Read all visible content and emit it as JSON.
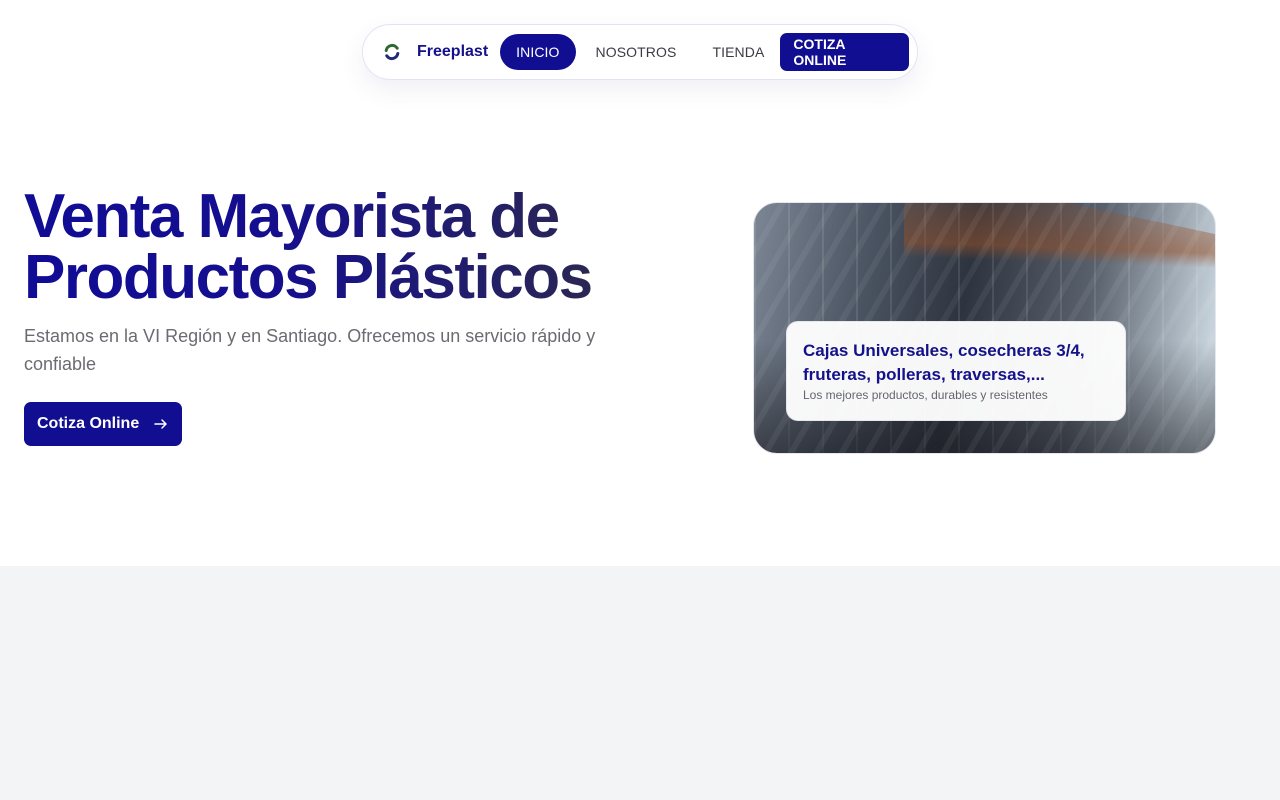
{
  "nav": {
    "brand": "Freeplast",
    "items": [
      {
        "label": "INICIO",
        "active": true
      },
      {
        "label": "NOSOTROS",
        "active": false
      },
      {
        "label": "TIENDA",
        "active": false
      }
    ],
    "cta": "COTIZA ONLINE",
    "logo_icon": "refresh-arrows-icon"
  },
  "hero": {
    "title_line1": "Venta Mayorista de",
    "title_line2": "Productos Plásticos",
    "subtitle": "Estamos en la VI Región y en Santiago. Ofrecemos un servicio rápido y confiable",
    "button_label": "Cotiza Online",
    "button_icon": "arrow-right-icon"
  },
  "feature_card": {
    "title": "Cajas Universales, cosecheras 3/4, fruteras, polleras, traversas,...",
    "subtitle": "Los mejores productos, durables y resistentes"
  },
  "colors": {
    "brand": "#120e91",
    "text_muted": "#6b6b72",
    "section_bg": "#f3f4f6"
  }
}
